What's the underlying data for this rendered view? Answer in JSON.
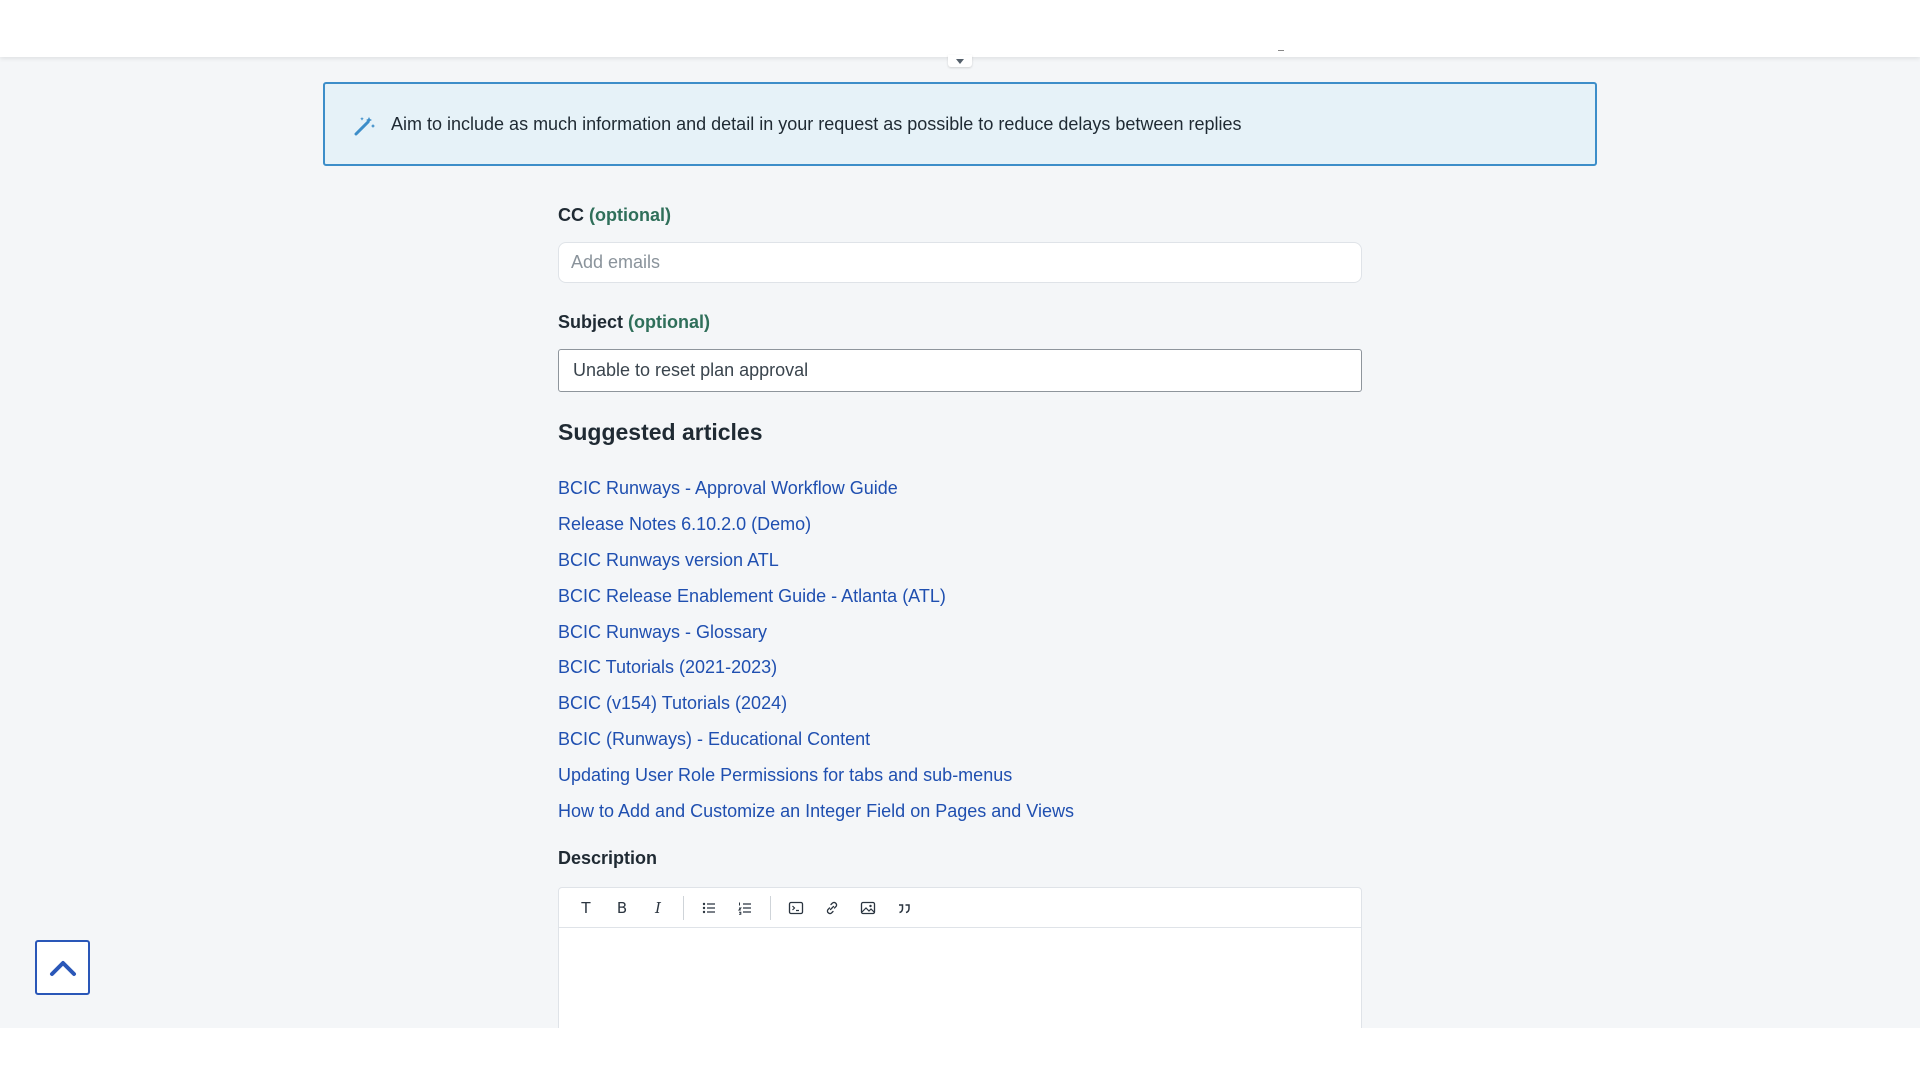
{
  "notice": {
    "text": "Aim to include as much information and detail in your request as possible to reduce delays between replies",
    "icon": "magic-wand-icon",
    "accent": "#3d8ec9"
  },
  "cc": {
    "label": "CC",
    "optional": "(optional)",
    "placeholder": "Add emails",
    "value": ""
  },
  "subject": {
    "label": "Subject",
    "optional": "(optional)",
    "value": "Unable to reset plan approval"
  },
  "suggested": {
    "title": "Suggested articles",
    "articles": [
      "BCIC Runways - Approval Workflow Guide",
      "Release Notes 6.10.2.0 (Demo)",
      "BCIC Runways version ATL",
      "BCIC Release Enablement Guide - Atlanta (ATL)",
      "BCIC Runways - Glossary",
      "BCIC Tutorials (2021-2023)",
      "BCIC (v154) Tutorials (2024)",
      "BCIC (Runways) - Educational Content",
      "Updating User Role Permissions for tabs and sub-menus",
      "How to Add and Customize an Integer Field on Pages and Views"
    ]
  },
  "description": {
    "label": "Description",
    "toolbar": {
      "text_style": "T",
      "bold": "B",
      "italic": "I"
    }
  },
  "colors": {
    "link": "#1f4fb0",
    "optional": "#2f6f5a",
    "page_bg": "#f4f6f8"
  }
}
